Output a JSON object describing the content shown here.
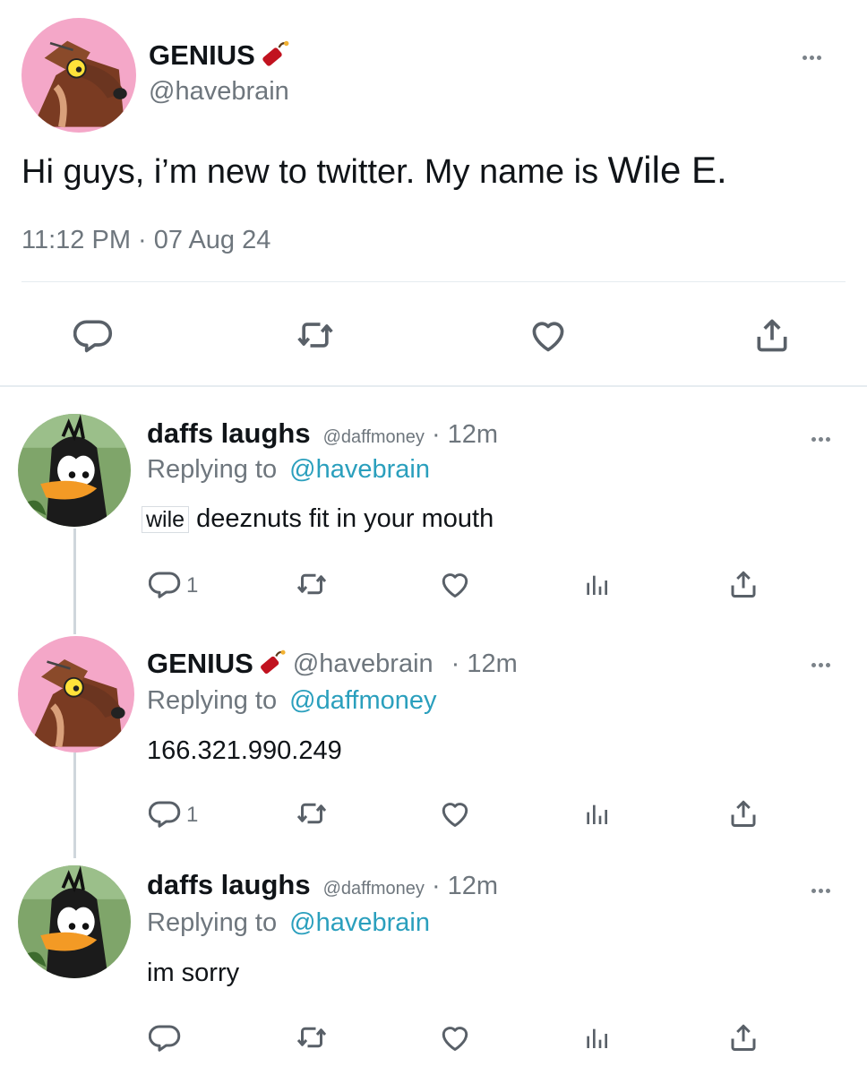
{
  "main_tweet": {
    "display_name": "GENIUS",
    "handle": "@havebrain",
    "text": "Hi guys, i’m new to twitter. My name is",
    "text_suffix": "Wile E.",
    "timestamp": "11:12 PM · 07 Aug 24"
  },
  "replies": [
    {
      "display_name": "daffs laughs",
      "handle": "@daffmoney",
      "time": "· 12m",
      "replying_prefix": "Replying to",
      "replying_to": "@havebrain",
      "text_prefix": "wile",
      "text": "deeznuts fit in your mouth",
      "reply_count": "1"
    },
    {
      "display_name": "GENIUS",
      "handle": "@havebrain",
      "time": "· 12m",
      "replying_prefix": "Replying to",
      "replying_to": "@daffmoney",
      "text": "166.321.990.249",
      "reply_count": "1"
    },
    {
      "display_name": "daffs laughs",
      "handle": "@daffmoney",
      "time": "· 12m",
      "replying_prefix": "Replying to",
      "replying_to": "@havebrain",
      "text": "im sorry",
      "reply_count": ""
    }
  ],
  "icons": {
    "reply": "reply-icon",
    "retweet": "retweet-icon",
    "like": "heart-icon",
    "views": "views-icon",
    "share": "share-icon",
    "more": "more-icon",
    "dynamite": "dynamite-icon"
  },
  "colors": {
    "link": "#2a9fbd",
    "muted": "#6e767d",
    "text": "#101418",
    "wile_bg": "#f4a7c8",
    "daffy_bg": "#7fa56a"
  }
}
